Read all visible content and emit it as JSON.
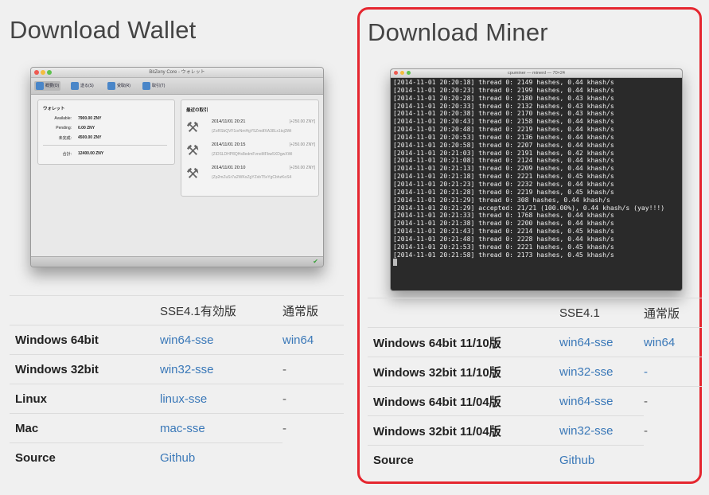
{
  "wallet": {
    "heading": "Download Wallet",
    "window": {
      "title": "BitZeny Core - ウォレット",
      "toolbar": [
        "概要(O)",
        "送る(S)",
        "受取(R)",
        "取引(T)"
      ],
      "wallet_panel": {
        "title": "ウォレット",
        "rows": [
          {
            "label": "Available:",
            "value": "7900.00 ZNY"
          },
          {
            "label": "Pending:",
            "value": "0.00 ZNY"
          },
          {
            "label": "未完成:",
            "value": "4500.00 ZNY"
          }
        ],
        "total_label": "合計:",
        "total_value": "12400.00 ZNY"
      },
      "recent_panel": {
        "title": "最近の取引",
        "items": [
          {
            "date": "2014/11/01 20:21",
            "amount": "[+250.00 ZNY]",
            "address": "(ZoRSbQVF1orNmHgY5ZmdfXA38Lx1tsj3Wi"
          },
          {
            "date": "2014/11/01 20:15",
            "amount": "[+250.00 ZNY]",
            "address": "(ZiDSLDHP8QHs8edmFvnoMFbw5XDgwXWi"
          },
          {
            "date": "2014/11/01 20:10",
            "amount": "[+250.00 ZNY]",
            "address": "(Zp2mZuSr7a2WKoZgYZxbT5vYgCbhzKoS4"
          }
        ]
      }
    },
    "table": {
      "headers": [
        "",
        "SSE4.1有効版",
        "通常版"
      ],
      "rows": [
        {
          "os": "Windows 64bit",
          "sse": "win64-sse",
          "normal": "win64"
        },
        {
          "os": "Windows 32bit",
          "sse": "win32-sse",
          "normal": "-"
        },
        {
          "os": "Linux",
          "sse": "linux-sse",
          "normal": "-"
        },
        {
          "os": "Mac",
          "sse": "mac-sse",
          "normal": "-"
        },
        {
          "os": "Source",
          "sse": "Github",
          "normal": ""
        }
      ]
    }
  },
  "miner": {
    "heading": "Download Miner",
    "terminal": {
      "title": "cpuminer — minerd — 70×24",
      "lines": [
        "[2014-11-01 20:20:18] thread 0: 2149 hashes, 0.44 khash/s",
        "[2014-11-01 20:20:23] thread 0: 2199 hashes, 0.44 khash/s",
        "[2014-11-01 20:20:28] thread 0: 2180 hashes, 0.43 khash/s",
        "[2014-11-01 20:20:33] thread 0: 2132 hashes, 0.43 khash/s",
        "[2014-11-01 20:20:38] thread 0: 2170 hashes, 0.43 khash/s",
        "[2014-11-01 20:20:43] thread 0: 2158 hashes, 0.44 khash/s",
        "[2014-11-01 20:20:48] thread 0: 2219 hashes, 0.44 khash/s",
        "[2014-11-01 20:20:53] thread 0: 2136 hashes, 0.44 khash/s",
        "[2014-11-01 20:20:58] thread 0: 2207 hashes, 0.44 khash/s",
        "[2014-11-01 20:21:03] thread 0: 2191 hashes, 0.42 khash/s",
        "[2014-11-01 20:21:08] thread 0: 2124 hashes, 0.44 khash/s",
        "[2014-11-01 20:21:13] thread 0: 2209 hashes, 0.44 khash/s",
        "[2014-11-01 20:21:18] thread 0: 2221 hashes, 0.45 khash/s",
        "[2014-11-01 20:21:23] thread 0: 2232 hashes, 0.44 khash/s",
        "[2014-11-01 20:21:28] thread 0: 2219 hashes, 0.45 khash/s",
        "[2014-11-01 20:21:29] thread 0: 308 hashes, 0.44 khash/s",
        "[2014-11-01 20:21:29] accepted: 21/21 (100.00%), 0.44 khash/s (yay!!!)",
        "[2014-11-01 20:21:33] thread 0: 1768 hashes, 0.44 khash/s",
        "[2014-11-01 20:21:38] thread 0: 2200 hashes, 0.44 khash/s",
        "[2014-11-01 20:21:43] thread 0: 2214 hashes, 0.45 khash/s",
        "[2014-11-01 20:21:48] thread 0: 2228 hashes, 0.44 khash/s",
        "[2014-11-01 20:21:53] thread 0: 2221 hashes, 0.45 khash/s",
        "[2014-11-01 20:21:58] thread 0: 2173 hashes, 0.45 khash/s"
      ]
    },
    "table": {
      "headers": [
        "",
        "SSE4.1",
        "通常版"
      ],
      "rows": [
        {
          "os": "Windows 64bit 11/10版",
          "sse": "win64-sse",
          "normal": "win64"
        },
        {
          "os": "Windows 32bit 11/10版",
          "sse": "win32-sse",
          "normal": "-"
        },
        {
          "os": "Windows 64bit 11/04版",
          "sse": "win64-sse",
          "normal": "-"
        },
        {
          "os": "Windows 32bit 11/04版",
          "sse": "win32-sse",
          "normal": "-"
        },
        {
          "os": "Source",
          "sse": "Github",
          "normal": ""
        }
      ]
    }
  },
  "colors": {
    "highlight_border": "#e5262f",
    "link": "#3a78b8"
  }
}
